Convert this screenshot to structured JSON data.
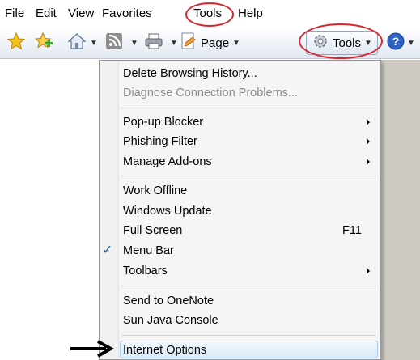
{
  "menubar": {
    "items": [
      "File",
      "Edit",
      "View",
      "Favorites",
      "Tools",
      "Help"
    ]
  },
  "toolbar": {
    "page_label": "Page",
    "tools_label": "Tools",
    "icons": [
      "favorites-star-icon",
      "add-favorites-icon",
      "home-icon",
      "rss-feed-icon",
      "print-icon",
      "page-icon",
      "gear-icon",
      "help-icon"
    ]
  },
  "tools_menu": {
    "items": [
      {
        "label": "Delete Browsing History..."
      },
      {
        "label": "Diagnose Connection Problems...",
        "disabled": true
      },
      {
        "label": "Pop-up Blocker",
        "submenu": true
      },
      {
        "label": "Phishing Filter",
        "submenu": true
      },
      {
        "label": "Manage Add-ons",
        "submenu": true
      },
      {
        "label": "Work Offline"
      },
      {
        "label": "Windows Update"
      },
      {
        "label": "Full Screen",
        "shortcut": "F11"
      },
      {
        "label": "Menu Bar",
        "checked": true
      },
      {
        "label": "Toolbars",
        "submenu": true
      },
      {
        "label": "Send to OneNote"
      },
      {
        "label": "Sun Java Console"
      },
      {
        "label": "Internet Options",
        "highlighted": true
      }
    ]
  },
  "colors": {
    "highlight_ring": "#d7262e",
    "check": "#1e5fb4",
    "page_background": "#cfcbc4"
  }
}
